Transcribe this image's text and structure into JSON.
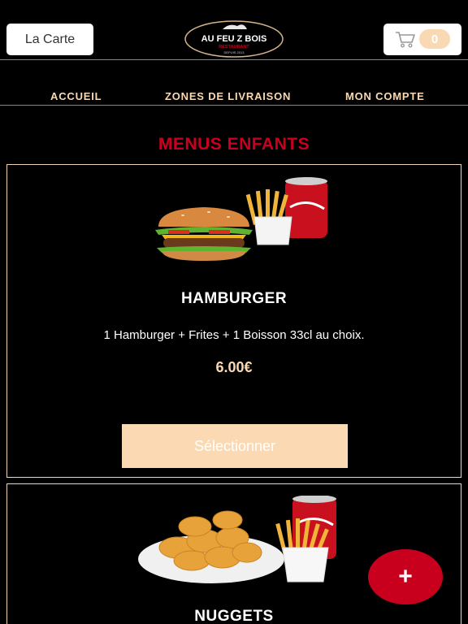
{
  "header": {
    "carte_label": "La Carte",
    "logo_line1": "AU FEU Z BOIS",
    "logo_line2": "RESTAURANT",
    "logo_line3": "DEPUIS 2013",
    "cart_count": "0"
  },
  "nav": {
    "items": [
      "ACCUEIL",
      "ZONES DE LIVRAISON",
      "MON COMPTE"
    ]
  },
  "section": {
    "title": "MENUS ENFANTS"
  },
  "products": [
    {
      "name": "HAMBURGER",
      "description": "1 Hamburger  + Frites  + 1 Boisson 33cl au choix.",
      "price": "6.00€",
      "button": "Sélectionner",
      "image": "burger-fries-cola"
    },
    {
      "name": "NUGGETS",
      "image": "nuggets-fries-cola"
    }
  ],
  "fab": {
    "label": "+"
  },
  "colors": {
    "accent_red": "#c8001e",
    "peach": "#f9d9b3",
    "background": "#000000"
  }
}
